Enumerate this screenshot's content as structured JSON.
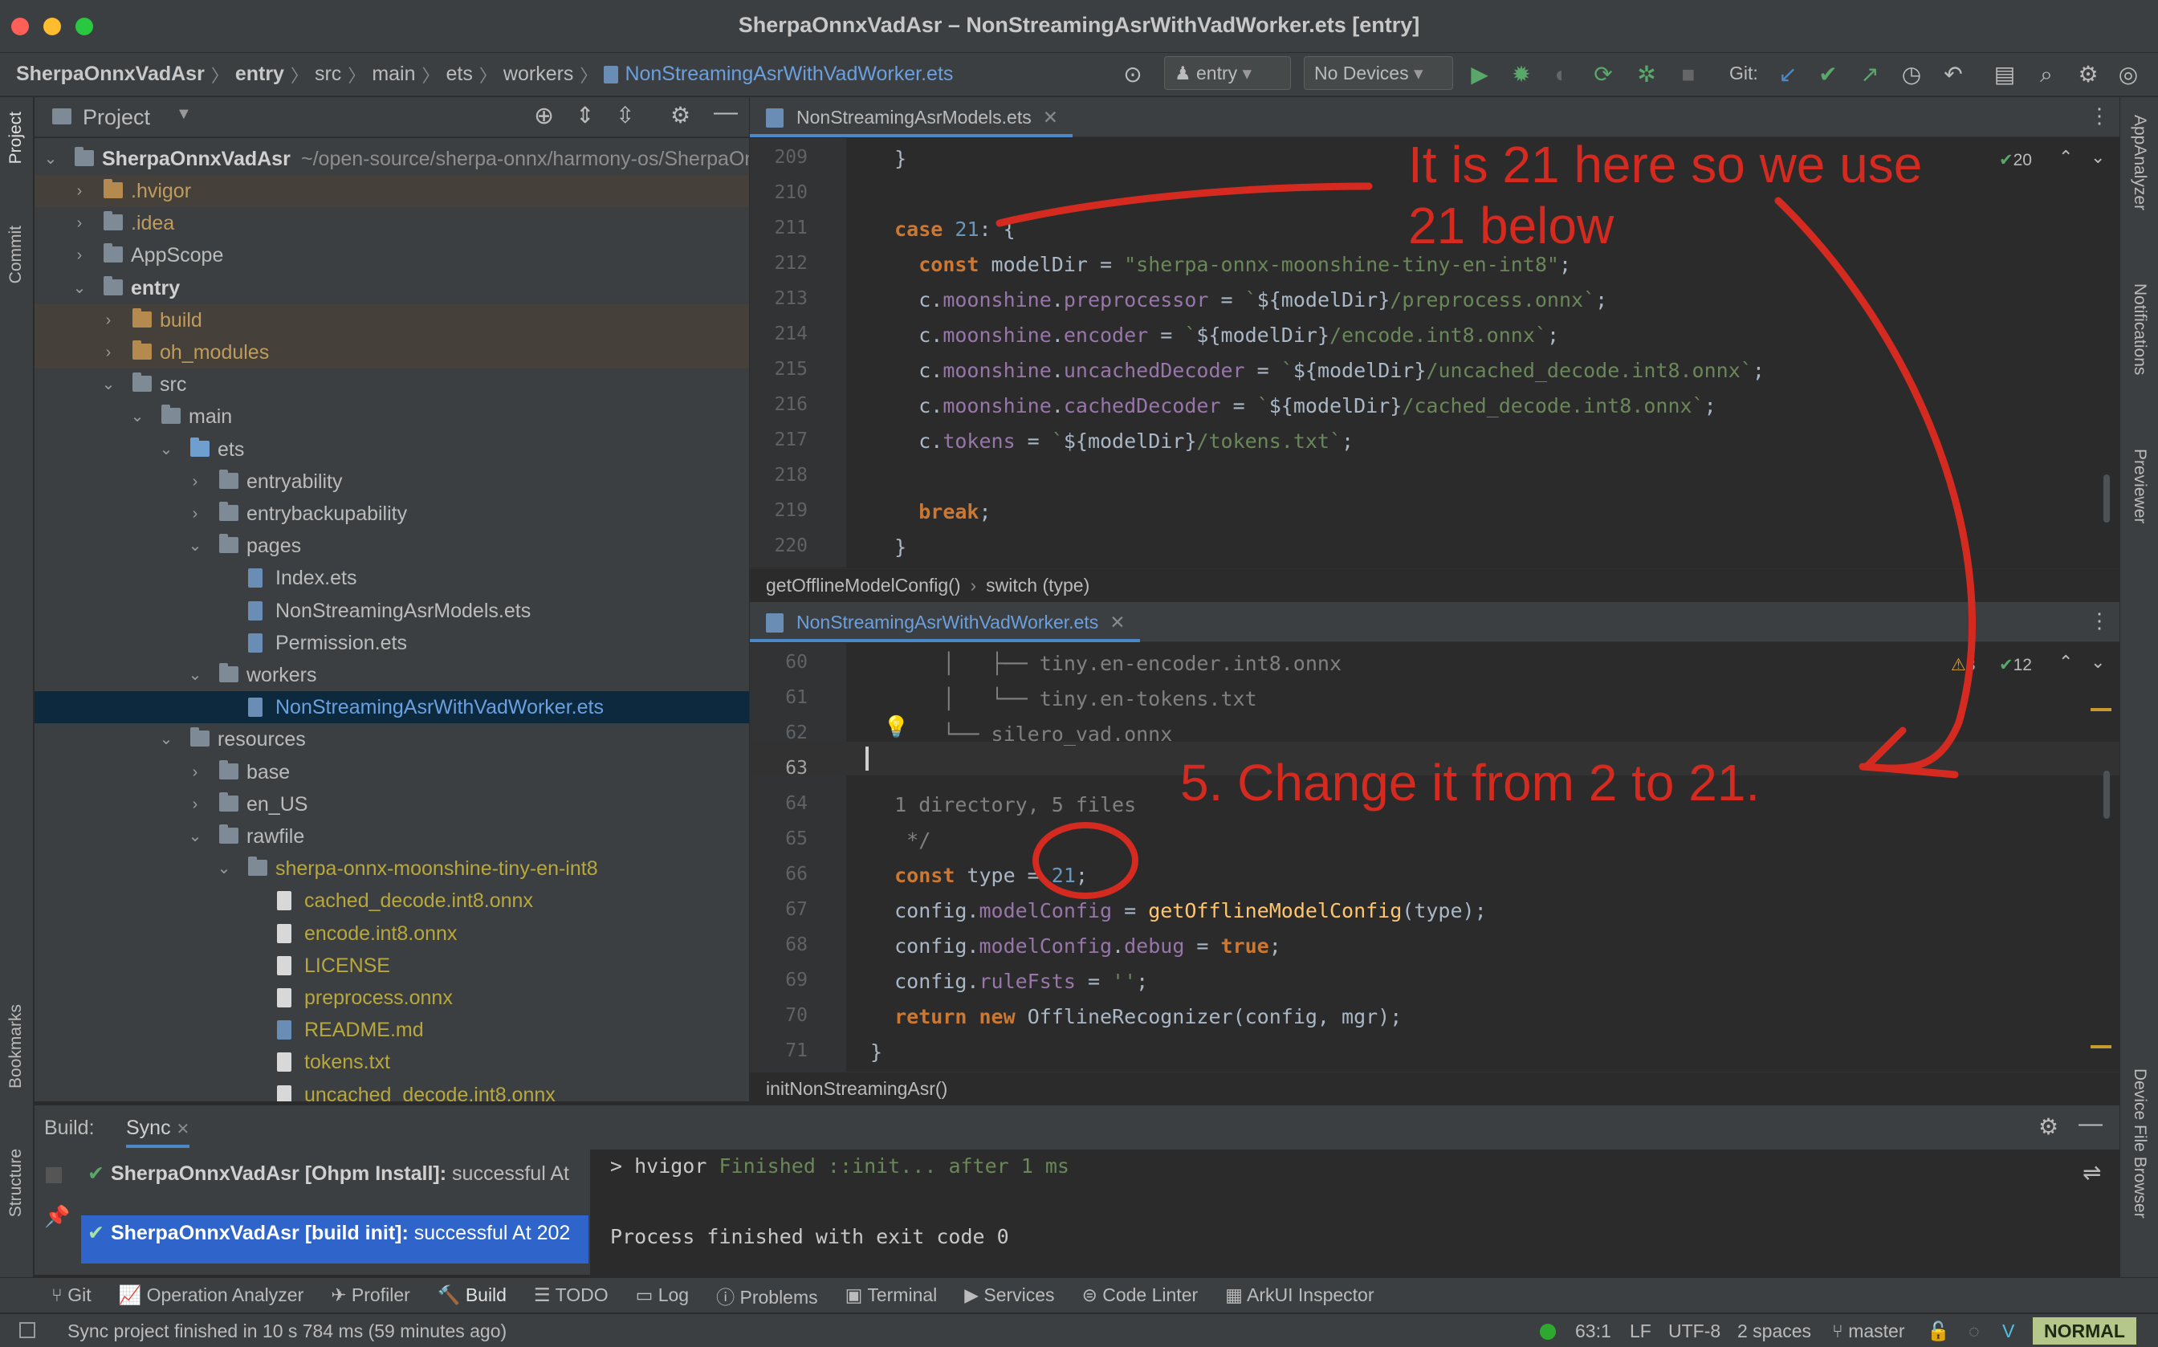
{
  "window": {
    "title": "SherpaOnnxVadAsr – NonStreamingAsrWithVadWorker.ets [entry]"
  },
  "breadcrumb": [
    "SherpaOnnxVadAsr",
    "entry",
    "src",
    "main",
    "ets",
    "workers",
    "NonStreamingAsrWithVadWorker.ets"
  ],
  "toolbar": {
    "run_config": "entry",
    "device": "No Devices",
    "git_label": "Git:"
  },
  "left_strip": {
    "project": "Project",
    "commit": "Commit",
    "bookmarks": "Bookmarks",
    "structure": "Structure"
  },
  "right_strip": {
    "appanalyzer": "AppAnalyzer",
    "notifications": "Notifications",
    "previewer": "Previewer",
    "device_file_browser": "Device File Browser"
  },
  "project_panel": {
    "title": "Project",
    "root_name": "SherpaOnnxVadAsr",
    "root_path": "~/open-source/sherpa-onnx/harmony-os/SherpaOnnxVadAsr",
    "items": [
      {
        "label": ".hvigor",
        "depth": 1,
        "arrow": "›",
        "kind": "folder-or",
        "color": "#c09c5c",
        "hl": true
      },
      {
        "label": ".idea",
        "depth": 1,
        "arrow": "›",
        "kind": "folder",
        "color": "#c09c5c",
        "hl": false
      },
      {
        "label": "AppScope",
        "depth": 1,
        "arrow": "›",
        "kind": "folder",
        "color": "#bbbbbb",
        "hl": false
      },
      {
        "label": "entry",
        "depth": 1,
        "arrow": "⌄",
        "kind": "folder",
        "color": "#d0d0d0",
        "hl": false,
        "bold": true
      },
      {
        "label": "build",
        "depth": 2,
        "arrow": "›",
        "kind": "folder-or",
        "color": "#c09c5c",
        "hl": true
      },
      {
        "label": "oh_modules",
        "depth": 2,
        "arrow": "›",
        "kind": "folder-or",
        "color": "#c09c5c",
        "hl": true
      },
      {
        "label": "src",
        "depth": 2,
        "arrow": "⌄",
        "kind": "folder",
        "color": "#bbbbbb",
        "hl": false
      },
      {
        "label": "main",
        "depth": 3,
        "arrow": "⌄",
        "kind": "folder",
        "color": "#bbbbbb",
        "hl": false
      },
      {
        "label": "ets",
        "depth": 4,
        "arrow": "⌄",
        "kind": "folder-bl",
        "color": "#bbbbbb",
        "hl": false
      },
      {
        "label": "entryability",
        "depth": 5,
        "arrow": "›",
        "kind": "folder",
        "color": "#bbbbbb",
        "hl": false
      },
      {
        "label": "entrybackupability",
        "depth": 5,
        "arrow": "›",
        "kind": "folder",
        "color": "#bbbbbb",
        "hl": false
      },
      {
        "label": "pages",
        "depth": 5,
        "arrow": "⌄",
        "kind": "folder",
        "color": "#bbbbbb",
        "hl": false
      },
      {
        "label": "Index.ets",
        "depth": 6,
        "arrow": "",
        "kind": "ets",
        "color": "#bbbbbb",
        "hl": false
      },
      {
        "label": "NonStreamingAsrModels.ets",
        "depth": 6,
        "arrow": "",
        "kind": "ets",
        "color": "#bbbbbb",
        "hl": false
      },
      {
        "label": "Permission.ets",
        "depth": 6,
        "arrow": "",
        "kind": "ets",
        "color": "#bbbbbb",
        "hl": false
      },
      {
        "label": "workers",
        "depth": 5,
        "arrow": "⌄",
        "kind": "folder",
        "color": "#bbbbbb",
        "hl": false
      },
      {
        "label": "NonStreamingAsrWithVadWorker.ets",
        "depth": 6,
        "arrow": "",
        "kind": "ets",
        "color": "#6aa0e0",
        "hl": false,
        "sel": true
      },
      {
        "label": "resources",
        "depth": 4,
        "arrow": "⌄",
        "kind": "folder",
        "color": "#bbbbbb",
        "hl": false
      },
      {
        "label": "base",
        "depth": 5,
        "arrow": "›",
        "kind": "folder",
        "color": "#bbbbbb",
        "hl": false
      },
      {
        "label": "en_US",
        "depth": 5,
        "arrow": "›",
        "kind": "folder",
        "color": "#bbbbbb",
        "hl": false
      },
      {
        "label": "rawfile",
        "depth": 5,
        "arrow": "⌄",
        "kind": "folder",
        "color": "#bbbbbb",
        "hl": false
      },
      {
        "label": "sherpa-onnx-moonshine-tiny-en-int8",
        "depth": 6,
        "arrow": "⌄",
        "kind": "folder",
        "color": "#b8a83c",
        "hl": false
      },
      {
        "label": "cached_decode.int8.onnx",
        "depth": 7,
        "arrow": "",
        "kind": "file",
        "color": "#b8a83c",
        "hl": false
      },
      {
        "label": "encode.int8.onnx",
        "depth": 7,
        "arrow": "",
        "kind": "file",
        "color": "#b8a83c",
        "hl": false
      },
      {
        "label": "LICENSE",
        "depth": 7,
        "arrow": "",
        "kind": "file",
        "color": "#b8a83c",
        "hl": false
      },
      {
        "label": "preprocess.onnx",
        "depth": 7,
        "arrow": "",
        "kind": "file",
        "color": "#b8a83c",
        "hl": false
      },
      {
        "label": "README.md",
        "depth": 7,
        "arrow": "",
        "kind": "ets",
        "color": "#b8a83c",
        "hl": false
      },
      {
        "label": "tokens.txt",
        "depth": 7,
        "arrow": "",
        "kind": "file",
        "color": "#b8a83c",
        "hl": false
      },
      {
        "label": "uncached_decode.int8.onnx",
        "depth": 7,
        "arrow": "",
        "kind": "file",
        "color": "#b8a83c",
        "hl": false
      }
    ]
  },
  "editor_top": {
    "tab": "NonStreamingAsrModels.ets",
    "inspection_count": "20",
    "lines": [
      {
        "n": "209",
        "html": "  <span class=\"id\">}</span>"
      },
      {
        "n": "210",
        "html": ""
      },
      {
        "n": "211",
        "html": "  <span class=\"kw\">case</span> <span class=\"num\">21</span>: {"
      },
      {
        "n": "212",
        "html": "    <span class=\"kw\">const</span> modelDir = <span class=\"st\">\"sherpa-onnx-moonshine-tiny-en-int8\"</span>;"
      },
      {
        "n": "213",
        "html": "    c.<span class=\"pl\">moonshine</span>.<span class=\"pl\">preprocessor</span> = <span class=\"st\">`</span>${modelDir}<span class=\"st\">/preprocess.onnx`</span>;"
      },
      {
        "n": "214",
        "html": "    c.<span class=\"pl\">moonshine</span>.<span class=\"pl\">encoder</span> = <span class=\"st\">`</span>${modelDir}<span class=\"st\">/encode.int8.onnx`</span>;"
      },
      {
        "n": "215",
        "html": "    c.<span class=\"pl\">moonshine</span>.<span class=\"pl\">uncachedDecoder</span> = <span class=\"st\">`</span>${modelDir}<span class=\"st\">/uncached_decode.int8.onnx`</span>;"
      },
      {
        "n": "216",
        "html": "    c.<span class=\"pl\">moonshine</span>.<span class=\"pl\">cachedDecoder</span> = <span class=\"st\">`</span>${modelDir}<span class=\"st\">/cached_decode.int8.onnx`</span>;"
      },
      {
        "n": "217",
        "html": "    c.<span class=\"pl\">tokens</span> = <span class=\"st\">`</span>${modelDir}<span class=\"st\">/tokens.txt`</span>;"
      },
      {
        "n": "218",
        "html": ""
      },
      {
        "n": "219",
        "html": "    <span class=\"kw\">break</span>;"
      },
      {
        "n": "220",
        "html": "  }"
      }
    ],
    "crumbs": [
      "getOfflineModelConfig()",
      "switch (type)"
    ]
  },
  "editor_bottom": {
    "tab": "NonStreamingAsrWithVadWorker.ets",
    "warnings": "3",
    "inspection_count": "12",
    "lines": [
      {
        "n": "60",
        "html": "<span class=\"cm\">      │   ├── tiny.en-encoder.int8.onnx</span>"
      },
      {
        "n": "61",
        "html": "<span class=\"cm\">      │   └── tiny.en-tokens.txt</span>"
      },
      {
        "n": "62",
        "html": "<span class=\"cm\">      └── silero_vad.onnx</span>"
      },
      {
        "n": "63",
        "html": ""
      },
      {
        "n": "64",
        "html": "<span class=\"cm\">  1 directory, 5 files</span>"
      },
      {
        "n": "65",
        "html": "<span class=\"cm\">   */</span>"
      },
      {
        "n": "66",
        "html": "  <span class=\"kw\">const</span> type = <span class=\"num\">21</span>;"
      },
      {
        "n": "67",
        "html": "  config.<span class=\"pl\">modelConfig</span> = <span class=\"fn\">getOfflineModelConfig</span>(type);"
      },
      {
        "n": "68",
        "html": "  config.<span class=\"pl\">modelConfig</span>.<span class=\"pl\">debug</span> = <span class=\"kw\">true</span>;"
      },
      {
        "n": "69",
        "html": "  config.<span class=\"pl\">ruleFsts</span> = <span class=\"st\">''</span>;"
      },
      {
        "n": "70",
        "html": "  <span class=\"kw\">return new</span> <span class=\"id\">OfflineRecognizer</span>(config, mgr);"
      },
      {
        "n": "71",
        "html": "}"
      }
    ],
    "crumbs": [
      "initNonStreamingAsr()"
    ]
  },
  "annotations": {
    "top_line1": "It is 21 here so we use",
    "top_line2": "21 below",
    "bottom": "5. Change it from 2 to 21."
  },
  "build_panel": {
    "label": "Build:",
    "tab": "Sync",
    "entries": [
      {
        "bold": "SherpaOnnxVadAsr [Ohpm Install]:",
        "rest": " successful At"
      },
      {
        "bold": "SherpaOnnxVadAsr [build init]:",
        "rest": " successful At 202"
      }
    ],
    "console_line1_prefix": "> hvigor ",
    "console_line1_rest": "Finished ::init... after 1 ms",
    "console_line2": "Process finished with exit code 0"
  },
  "bottom_tabs": [
    "Git",
    "Operation Analyzer",
    "Profiler",
    "Build",
    "TODO",
    "Log",
    "Problems",
    "Terminal",
    "Services",
    "Code Linter",
    "ArkUI Inspector"
  ],
  "status": {
    "message": "Sync project finished in 10 s 784 ms (59 minutes ago)",
    "position": "63:1",
    "line_sep": "LF",
    "encoding": "UTF-8",
    "indent": "2 spaces",
    "branch": "master",
    "mode": "NORMAL"
  },
  "colors": {
    "annotation": "#d42a20",
    "accent": "#4a88c7",
    "run": "#59a869"
  }
}
